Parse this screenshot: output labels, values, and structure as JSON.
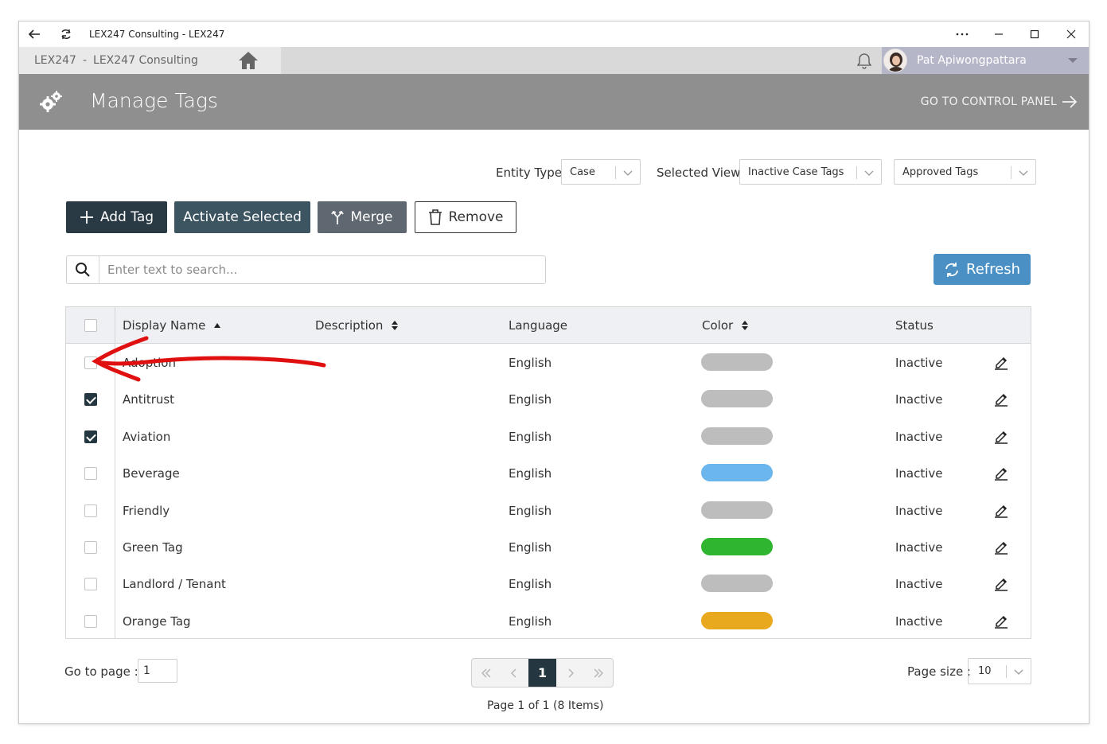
{
  "window": {
    "title": "LEX247 Consulting - LEX247"
  },
  "tabs": {
    "org": "LEX247",
    "separator": "-",
    "company": "LEX247 Consulting"
  },
  "user": {
    "name": "Pat Apiwongpattara"
  },
  "header": {
    "title": "Manage Tags",
    "control_panel_label": "GO TO CONTROL PANEL"
  },
  "filters": {
    "entity_type_label": "Entity Type",
    "entity_type_value": "Case",
    "selected_view_label": "Selected View",
    "selected_view_value": "Inactive Case Tags",
    "tag_filter_value": "Approved Tags"
  },
  "toolbar": {
    "add_label": "Add Tag",
    "activate_label": "Activate Selected",
    "merge_label": "Merge",
    "remove_label": "Remove",
    "refresh_label": "Refresh"
  },
  "search": {
    "placeholder": "Enter text to search..."
  },
  "table": {
    "columns": {
      "display_name": "Display Name",
      "description": "Description",
      "language": "Language",
      "color": "Color",
      "status": "Status"
    },
    "rows": [
      {
        "name": "Adoption",
        "description": "",
        "language": "English",
        "color": "#bdbdbd",
        "status": "Inactive",
        "checked": false
      },
      {
        "name": "Antitrust",
        "description": "",
        "language": "English",
        "color": "#bdbdbd",
        "status": "Inactive",
        "checked": true
      },
      {
        "name": "Aviation",
        "description": "",
        "language": "English",
        "color": "#bdbdbd",
        "status": "Inactive",
        "checked": true
      },
      {
        "name": "Beverage",
        "description": "",
        "language": "English",
        "color": "#6cb6ee",
        "status": "Inactive",
        "checked": false
      },
      {
        "name": "Friendly",
        "description": "",
        "language": "English",
        "color": "#bdbdbd",
        "status": "Inactive",
        "checked": false
      },
      {
        "name": "Green Tag",
        "description": "",
        "language": "English",
        "color": "#2fb52f",
        "status": "Inactive",
        "checked": false
      },
      {
        "name": "Landlord / Tenant",
        "description": "",
        "language": "English",
        "color": "#bdbdbd",
        "status": "Inactive",
        "checked": false
      },
      {
        "name": "Orange Tag",
        "description": "",
        "language": "English",
        "color": "#e8a91e",
        "status": "Inactive",
        "checked": false
      }
    ]
  },
  "pager": {
    "goto_label": "Go to page :",
    "goto_value": "1",
    "current_page": "1",
    "info": "Page 1 of 1 (8 Items)",
    "page_size_label": "Page size :",
    "page_size_value": "10"
  },
  "colors": {
    "header_bg": "#8f8f8f",
    "primary_dark": "#2a3a44",
    "refresh_blue": "#4a90c4",
    "annotation_red": "#e01010"
  },
  "icons": [
    "back-arrow-icon",
    "reload-icon",
    "more-icon",
    "minimize-icon",
    "maximize-icon",
    "close-icon",
    "home-icon",
    "bell-icon",
    "gear-icon",
    "arrow-right-icon",
    "plus-icon",
    "merge-icon",
    "trash-icon",
    "search-icon",
    "refresh-icon",
    "sort-asc-icon",
    "sort-both-icon",
    "edit-icon",
    "first-page-icon",
    "prev-page-icon",
    "next-page-icon",
    "last-page-icon",
    "chevron-down-icon"
  ]
}
